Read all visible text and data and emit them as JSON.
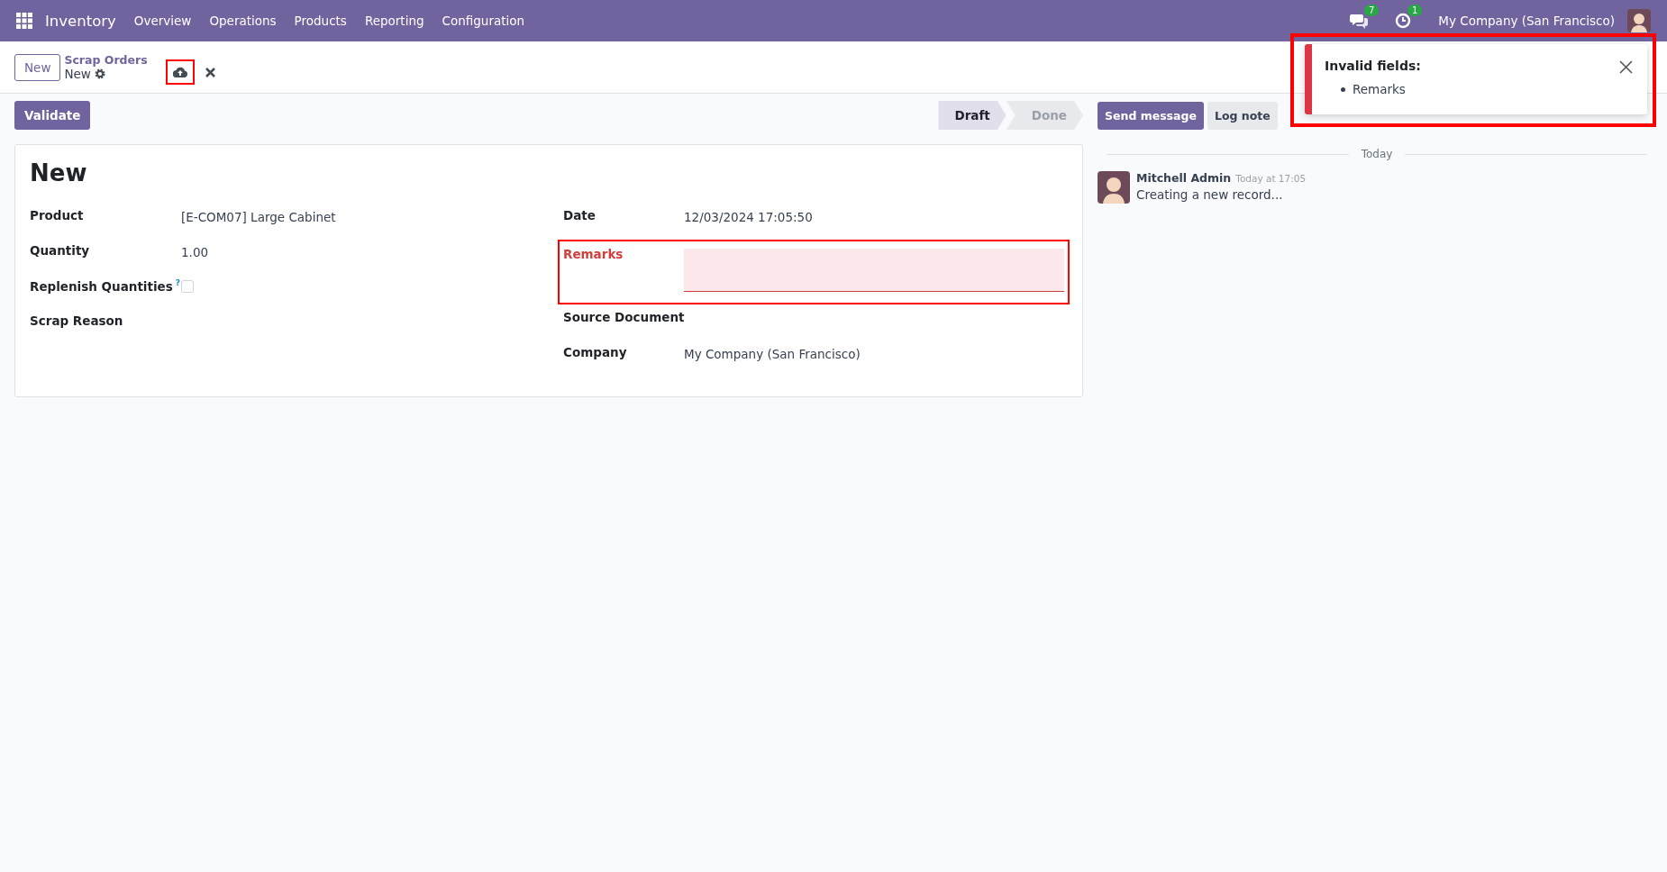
{
  "navbar": {
    "app_name": "Inventory",
    "menu": [
      "Overview",
      "Operations",
      "Products",
      "Reporting",
      "Configuration"
    ],
    "messages_count": "7",
    "activities_count": "1",
    "company": "My Company (San Francisco)"
  },
  "control_panel": {
    "new_button": "New",
    "breadcrumb_parent": "Scrap Orders",
    "breadcrumb_current": "New",
    "save_highlighted": true
  },
  "action_button": "Validate",
  "statusbar": [
    {
      "label": "Draft",
      "selected": true
    },
    {
      "label": "Done",
      "selected": false
    }
  ],
  "form": {
    "title": "New",
    "left_fields": [
      {
        "kind": "text",
        "label": "Product",
        "value": "[E-COM07] Large Cabinet"
      },
      {
        "kind": "text",
        "label": "Quantity",
        "value": "1.00"
      },
      {
        "kind": "checkbox",
        "label": "Replenish Quantities",
        "help": "?",
        "checked": false
      },
      {
        "kind": "text",
        "label": "Scrap Reason"
      }
    ],
    "right_fields": [
      {
        "kind": "text",
        "label": "Date",
        "value": "12/03/2024 17:05:50"
      },
      {
        "kind": "textarea",
        "label": "Remarks",
        "invalid": true,
        "highlighted": true
      },
      {
        "kind": "text",
        "label": "Source Document"
      },
      {
        "kind": "text",
        "label": "Company",
        "value": "My Company (San Francisco)"
      }
    ]
  },
  "chatter": {
    "buttons": [
      {
        "kind": "primary",
        "label": "Send message"
      },
      {
        "kind": "secondary",
        "label": "Log note"
      }
    ],
    "date_separator": "Today",
    "messages": [
      {
        "author": "Mitchell Admin",
        "time": "Today at 17:05",
        "body": "Creating a new record..."
      }
    ]
  },
  "toast": {
    "title": "Invalid fields:",
    "items": [
      "Remarks"
    ],
    "highlighted": true
  }
}
